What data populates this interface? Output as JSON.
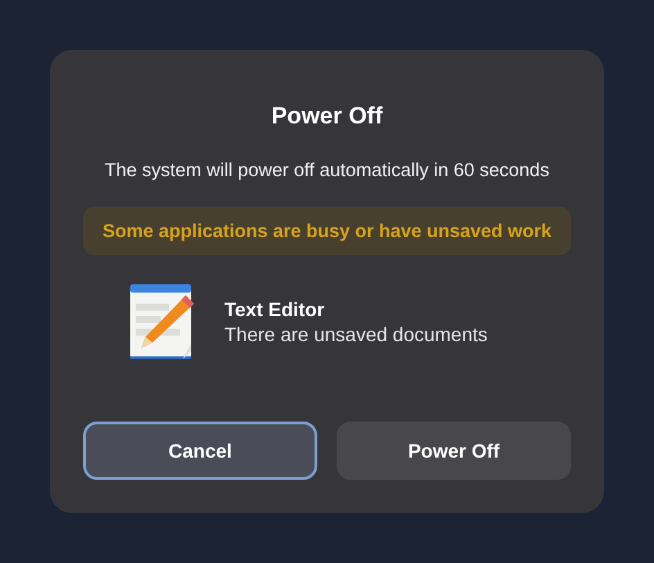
{
  "dialog": {
    "title": "Power Off",
    "message": "The system will power off automatically in 60 seconds",
    "warning": "Some applications are busy or have unsaved work",
    "apps": [
      {
        "name": "Text Editor",
        "status": "There are unsaved documents"
      }
    ],
    "buttons": [
      {
        "label": "Cancel",
        "selected": true
      },
      {
        "label": "Power Off",
        "selected": false
      }
    ]
  }
}
